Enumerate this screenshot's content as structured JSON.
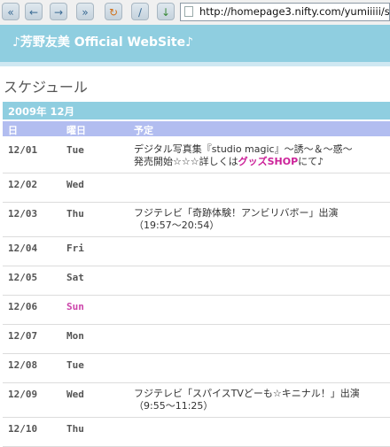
{
  "browser": {
    "url": "http://homepage3.nifty.com/yumiiiii/s"
  },
  "site": {
    "title": "♪芳野友美 Official WebSite♪"
  },
  "page": {
    "heading": "スケジュール"
  },
  "schedule": {
    "month_label": "2009年 12月",
    "columns": [
      "日",
      "曜日",
      "予定"
    ],
    "rows": [
      {
        "date": "12/01",
        "day": "Tue",
        "line1": "デジタル写真集『studio magic』～誘～＆～惑～",
        "line2_pre": "発売開始☆☆☆詳しくは",
        "line2_link": "グッズSHOP",
        "line2_post": "にて♪"
      },
      {
        "date": "12/02",
        "day": "Wed"
      },
      {
        "date": "12/03",
        "day": "Thu",
        "line1": "フジテレビ「奇跡体験！アンビリバボー」出演",
        "line2": "（19:57～20:54）"
      },
      {
        "date": "12/04",
        "day": "Fri"
      },
      {
        "date": "12/05",
        "day": "Sat"
      },
      {
        "date": "12/06",
        "day": "Sun"
      },
      {
        "date": "12/07",
        "day": "Mon"
      },
      {
        "date": "12/08",
        "day": "Tue"
      },
      {
        "date": "12/09",
        "day": "Wed",
        "line1": "フジテレビ「スパイスTVどーも☆キニナル！」出演",
        "line2": "（9:55～11:25）"
      },
      {
        "date": "12/10",
        "day": "Thu"
      }
    ]
  }
}
